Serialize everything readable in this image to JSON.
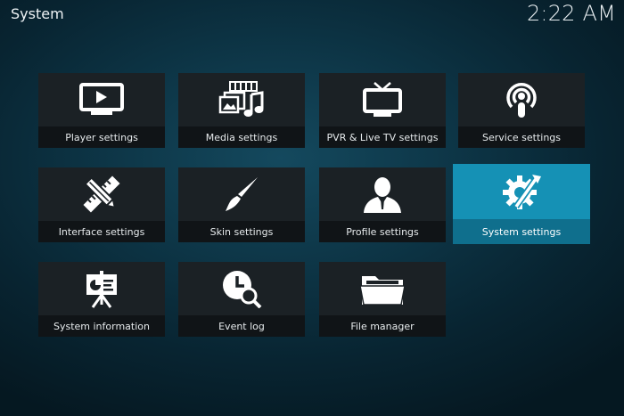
{
  "header": {
    "title": "System",
    "clock": "2:22 AM"
  },
  "tiles": [
    {
      "label": "Player settings",
      "icon": "player-icon"
    },
    {
      "label": "Media settings",
      "icon": "media-icon"
    },
    {
      "label": "PVR & Live TV settings",
      "icon": "tv-icon"
    },
    {
      "label": "Service settings",
      "icon": "podcast-icon"
    },
    {
      "label": "Interface settings",
      "icon": "pencil-ruler-icon"
    },
    {
      "label": "Skin settings",
      "icon": "brush-icon"
    },
    {
      "label": "Profile settings",
      "icon": "person-icon"
    },
    {
      "label": "System settings",
      "icon": "gear-wrench-icon"
    },
    {
      "label": "System information",
      "icon": "presentation-icon"
    },
    {
      "label": "Event log",
      "icon": "clock-search-icon"
    },
    {
      "label": "File manager",
      "icon": "folder-icon"
    }
  ],
  "focused_index": 7,
  "colors": {
    "accent": "#128aad",
    "tile": "#1b2125",
    "label_bar": "#101417"
  }
}
